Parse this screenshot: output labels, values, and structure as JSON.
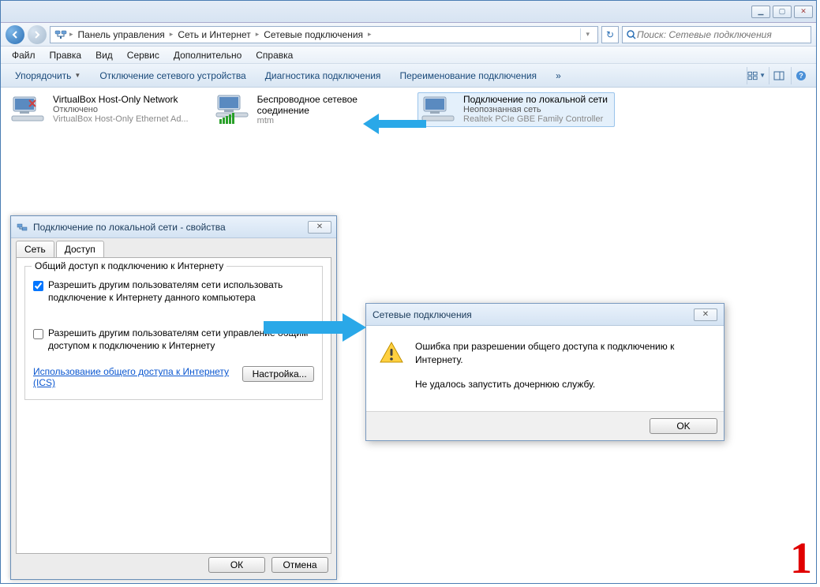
{
  "breadcrumb": {
    "seg1": "Панель управления",
    "seg2": "Сеть и Интернет",
    "seg3": "Сетевые подключения"
  },
  "search": {
    "placeholder": "Поиск: Сетевые подключения"
  },
  "menu": {
    "file": "Файл",
    "edit": "Правка",
    "view": "Вид",
    "tools": "Сервис",
    "advanced": "Дополнительно",
    "help": "Справка"
  },
  "cmdbar": {
    "organize": "Упорядочить",
    "disable": "Отключение сетевого устройства",
    "diagnose": "Диагностика подключения",
    "rename": "Переименование подключения",
    "chevron": "»"
  },
  "connections": [
    {
      "name": "VirtualBox Host-Only Network",
      "status": "Отключено",
      "device": "VirtualBox Host-Only Ethernet Ad..."
    },
    {
      "name": "Беспроводное сетевое соединение",
      "status": "",
      "device": "mtm"
    },
    {
      "name": "Подключение по локальной сети",
      "status": "Неопознанная сеть",
      "device": "Realtek PCIe GBE Family Controller"
    }
  ],
  "propdlg": {
    "title": "Подключение по локальной сети - свойства",
    "tab_network": "Сеть",
    "tab_sharing": "Доступ",
    "group_label": "Общий доступ к подключению к Интернету",
    "chk1": "Разрешить другим пользователям сети использовать подключение к Интернету данного компьютера",
    "chk2": "Разрешить другим пользователям сети управление общим доступом к подключению к Интернету",
    "link": "Использование общего доступа к Интернету (ICS)",
    "settings_btn": "Настройка...",
    "ok": "ОК",
    "cancel": "Отмена"
  },
  "errdlg": {
    "title": "Сетевые подключения",
    "line1": "Ошибка при разрешении общего доступа к подключению к Интернету.",
    "line2": "Не удалось запустить дочернюю службу.",
    "ok": "OK"
  },
  "annotation_num": "1"
}
